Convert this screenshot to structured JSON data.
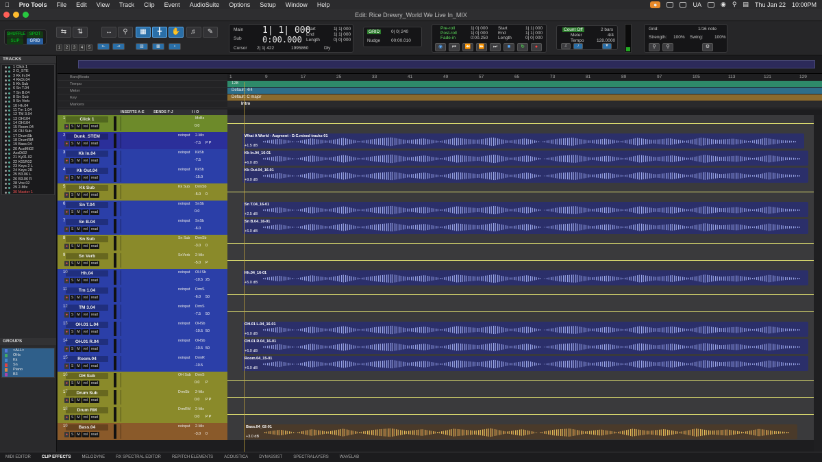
{
  "menubar": {
    "app": "Pro Tools",
    "items": [
      "File",
      "Edit",
      "View",
      "Track",
      "Clip",
      "Event",
      "AudioSuite",
      "Options",
      "Setup",
      "Window",
      "Help"
    ],
    "input_source": "UA",
    "date": "Thu Jan 22",
    "time": "10:00PM"
  },
  "window": {
    "title": "Edit: Rice Drewry_World We Live In_MIX"
  },
  "toolbar": {
    "modes": {
      "shuffle": "SHUFFLE",
      "spot": "SPOT",
      "slip": "SLIP",
      "grid": "GRID"
    },
    "zoom_presets": [
      "1",
      "2",
      "3",
      "4",
      "5"
    ],
    "counter": {
      "main_label": "Main",
      "main_value": "1| 1| 000",
      "sub_label": "Sub",
      "sub_value": "0:00.000",
      "start_label": "Start",
      "start_value": "1| 1| 000",
      "end_label": "End",
      "end_value": "1| 1| 000",
      "length_label": "Length",
      "length_value": "0| 0| 000",
      "cursor_label": "Cursor",
      "cursor_value": "2| 1| 422",
      "samples": "1995860",
      "dly": "Dly"
    },
    "grid_nudge": {
      "grid_badge": "GRID",
      "grid_value": "0| 0| 240",
      "nudge_label": "Nudge",
      "nudge_value": "00:00.010"
    },
    "transport": {
      "preroll_label": "Pre-roll",
      "preroll_value": "1| 0| 000",
      "postroll_label": "Post-roll",
      "postroll_value": "1| 0| 000",
      "fadein_label": "Fade-in",
      "fadein_value": "0:00.250",
      "start_label": "Start",
      "start_value": "1| 1| 000",
      "end_label": "End",
      "end_value": "1| 1| 000",
      "length_label": "Length",
      "length_value": "0| 0| 000"
    },
    "count": {
      "countoff_label": "Count Off",
      "countoff_value": "2 bars",
      "meter_label": "Meter",
      "meter_value": "4/4",
      "tempo_label": "Tempo",
      "tempo_value": "128.0000"
    },
    "gridpanel": {
      "grid_label": "Grid:",
      "grid_value": "1/16 note",
      "strength_label": "Strength:",
      "strength_value": "100%",
      "swing_label": "Swing:",
      "swing_value": "100%"
    }
  },
  "tracks_panel": {
    "title": "TRACKS",
    "items": [
      "1 Click 1",
      "2 G_STE",
      "3 Kk In.04",
      "4 KkOt.04",
      "5 Kk Sub",
      "6 Sn T.04",
      "7 Sn B.04",
      "8 Sn Sub",
      "9 Sn Verb",
      "10 Hh.04",
      "11 Tm 1.04",
      "12 TM 3.04",
      "13 OH104",
      "14 OH104",
      "15 Room.04",
      "16 OH Sub",
      "17 DrumSb",
      "18 DrumRM",
      "19 Bass.04",
      "20 AcstMi02",
      "   AcsDi02",
      "21 Ky01.02",
      "22 K01R02",
      "23 Keys 2 L",
      "24 Keys 2R",
      "25 B3.06 L",
      "26 B3.06 R",
      "28 Vox.02",
      "29 2-Mix",
      "30 Master 1"
    ]
  },
  "groups_panel": {
    "title": "GROUPS",
    "items": [
      "<ALL>",
      "OHs",
      "Kk",
      "Sn",
      "Piano",
      "B3"
    ]
  },
  "rulers": {
    "barsbeats_label": "Bars|Beats",
    "tempo_label": "Tempo",
    "tempo_value": "128",
    "meter_label": "Meter",
    "meter_value": "Default: 4/4",
    "key_label": "Key",
    "key_value": "Default: C major",
    "markers_label": "Markers",
    "marker_text": "Intro",
    "bars": [
      "1",
      "9",
      "17",
      "25",
      "33",
      "41",
      "49",
      "57",
      "65",
      "73",
      "81",
      "89",
      "97",
      "105",
      "113",
      "121",
      "129"
    ]
  },
  "columns": {
    "inserts": "INSERTS A-E",
    "sends": "SENDS F-J",
    "io": "I / O"
  },
  "tracks": [
    {
      "num": "1",
      "name": "Click 1",
      "color": "#6d8a2a",
      "input": "",
      "output": "MxBs",
      "vol": "0.0",
      "pan": "",
      "clip": "",
      "gain": ""
    },
    {
      "num": "2",
      "name": "Dunk_STEM",
      "color": "#2b2f9a",
      "input": "noinput",
      "output": "2-Mix",
      "vol": "-7.5",
      "pan": "P P",
      "clip": "What A World  - Augment - D.C.mixed tracks-01",
      "gain": "+1.5 dB"
    },
    {
      "num": "3",
      "name": "Kk In.04",
      "color": "#2b3fa8",
      "input": "noinput",
      "output": "KkSb",
      "vol": "-7.5",
      "pan": "",
      "clip": "Kk In.04_16-01",
      "gain": "+6.0 dB"
    },
    {
      "num": "4",
      "name": "Kk Out.04",
      "color": "#2b3fa8",
      "input": "noinput",
      "output": "KkSb",
      "vol": "-15.0",
      "pan": "",
      "clip": "Kk Out.04_16-01",
      "gain": "+9.0 dB"
    },
    {
      "num": "5",
      "name": "Kk Sub",
      "color": "#8a8a2a",
      "input": "Kk Sub",
      "output": "DrmSb",
      "vol": "-5.0",
      "pan": "0",
      "clip": "",
      "gain": ""
    },
    {
      "num": "6",
      "name": "Sn T.04",
      "color": "#2b3fa8",
      "input": "noinput",
      "output": "SnSb",
      "vol": "0.0",
      "pan": "",
      "clip": "Sn T.04_16-01",
      "gain": "+2.5 dB"
    },
    {
      "num": "7",
      "name": "Sn B.04",
      "color": "#2b3fa8",
      "input": "noinput",
      "output": "SnSb",
      "vol": "-6.0",
      "pan": "",
      "clip": "Sn B.04_16-01",
      "gain": "+6.0 dB"
    },
    {
      "num": "8",
      "name": "Sn Sub",
      "color": "#8a8a2a",
      "input": "Sn Sub",
      "output": "DrmSb",
      "vol": "-3.0",
      "pan": "0",
      "clip": "",
      "gain": ""
    },
    {
      "num": "9",
      "name": "Sn Verb",
      "color": "#8a8a2a",
      "input": "SnVerb",
      "output": "2-Mix",
      "vol": "-5.0",
      "pan": "P",
      "clip": "",
      "gain": ""
    },
    {
      "num": "10",
      "name": "Hh.04",
      "color": "#2b3fa8",
      "input": "noinput",
      "output": "OH Sb",
      "vol": "-10.5",
      "pan": "25",
      "clip": "Hh.04_16-01",
      "gain": "+5.0 dB"
    },
    {
      "num": "11",
      "name": "Tm 1.04",
      "color": "#2b3fa8",
      "input": "noinput",
      "output": "DrmS",
      "vol": "-6.0",
      "pan": "50",
      "clip": "",
      "gain": ""
    },
    {
      "num": "12",
      "name": "TM 3.04",
      "color": "#2b3fa8",
      "input": "noinput",
      "output": "DrmS",
      "vol": "-7.5",
      "pan": "50",
      "clip": "",
      "gain": ""
    },
    {
      "num": "13",
      "name": "OH.01 L.04",
      "color": "#2b3fa8",
      "input": "noinput",
      "output": "OHSb",
      "vol": "-10.5",
      "pan": "50",
      "clip": "OH.01 L.04_16-01",
      "gain": "+6.0 dB"
    },
    {
      "num": "14",
      "name": "OH.01 R.04",
      "color": "#2b3fa8",
      "input": "noinput",
      "output": "OHSb",
      "vol": "-10.5",
      "pan": "50",
      "clip": "OH.01 R.04_16-01",
      "gain": "+6.0 dB"
    },
    {
      "num": "15",
      "name": "Room.04",
      "color": "#2b3fa8",
      "input": "noinput",
      "output": "DrmR",
      "vol": "-10.5",
      "pan": "",
      "clip": "Room.04_15-01",
      "gain": "+6.0 dB"
    },
    {
      "num": "16",
      "name": "OH Sub",
      "color": "#8a8a2a",
      "input": "OH Sub",
      "output": "DrmS",
      "vol": "0.0",
      "pan": "P",
      "clip": "",
      "gain": ""
    },
    {
      "num": "17",
      "name": "Drum Sub",
      "color": "#8a8a2a",
      "input": "DrmSb",
      "output": "2-Mix",
      "vol": "0.0",
      "pan": "P P",
      "clip": "",
      "gain": ""
    },
    {
      "num": "18",
      "name": "Drum RM",
      "color": "#8a8a2a",
      "input": "DrmRM",
      "output": "2-Mix",
      "vol": "0.0",
      "pan": "P P",
      "clip": "",
      "gain": ""
    },
    {
      "num": "19",
      "name": "Bass.04",
      "color": "#8a5a2a",
      "input": "noinput",
      "output": "2-Mix",
      "vol": "-3.0",
      "pan": "0",
      "clip": "Bass.04_02-01",
      "gain": "+3.0 dB"
    }
  ],
  "bottom_tabs": [
    "MIDI EDITOR",
    "CLIP EFFECTS",
    "MELODYNE",
    "RX SPECTRAL EDITOR",
    "REPITCH ELEMENTS",
    "ACOUSTICA",
    "DYNASSIST",
    "SPECTRALAYERS",
    "WAVELAB"
  ]
}
